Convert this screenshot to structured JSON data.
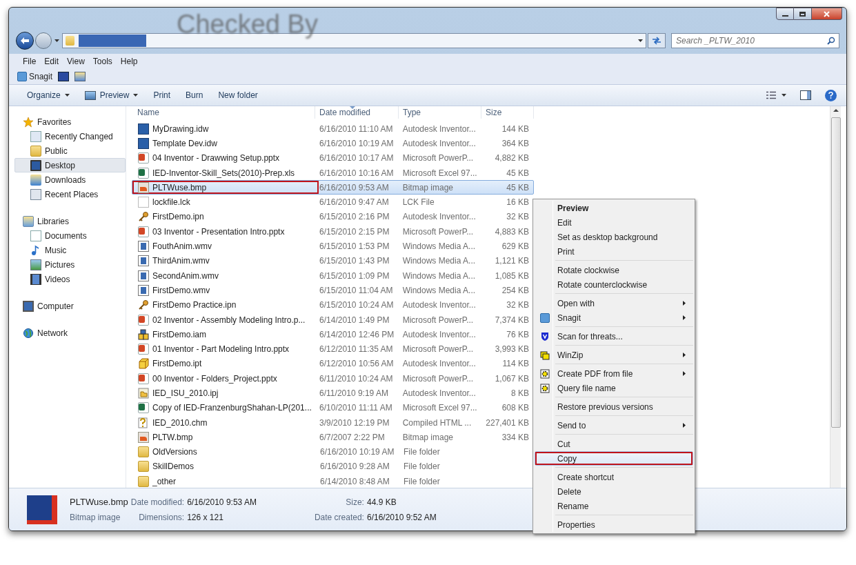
{
  "backdrop_text": "Checked By",
  "address_bar": {
    "search": {
      "placeholder": "Search _PLTW_2010"
    }
  },
  "menu_bar": [
    "File",
    "Edit",
    "View",
    "Tools",
    "Help"
  ],
  "snagit_toolbar": {
    "label": "Snagit"
  },
  "command_bar": [
    {
      "label": "Organize",
      "dropdown": true,
      "kind": "plain"
    },
    {
      "label": "Preview",
      "dropdown": true,
      "kind": "preview"
    },
    {
      "label": "Print",
      "dropdown": false,
      "kind": "plain"
    },
    {
      "label": "Burn",
      "dropdown": false,
      "kind": "plain"
    },
    {
      "label": "New folder",
      "dropdown": false,
      "kind": "plain"
    }
  ],
  "sidebar": [
    {
      "label": "Favorites",
      "kind": "star",
      "children": [
        {
          "label": "Recently Changed",
          "kind": "recent",
          "selected": false
        },
        {
          "label": "Public",
          "kind": "folder",
          "selected": false
        },
        {
          "label": "Desktop",
          "kind": "desktop",
          "selected": true
        },
        {
          "label": "Downloads",
          "kind": "downloads",
          "selected": false
        },
        {
          "label": "Recent Places",
          "kind": "places",
          "selected": false
        }
      ]
    },
    {
      "label": "Libraries",
      "kind": "libraries",
      "children": [
        {
          "label": "Documents",
          "kind": "documents",
          "selected": false
        },
        {
          "label": "Music",
          "kind": "music",
          "selected": false
        },
        {
          "label": "Pictures",
          "kind": "pictures",
          "selected": false
        },
        {
          "label": "Videos",
          "kind": "videos",
          "selected": false
        }
      ]
    },
    {
      "label": "Computer",
      "kind": "computer"
    },
    {
      "label": "Network",
      "kind": "network"
    }
  ],
  "table": {
    "columns": [
      {
        "label": "Name",
        "sorted": false
      },
      {
        "label": "Date modified",
        "sorted": true
      },
      {
        "label": "Type",
        "sorted": false
      },
      {
        "label": "Size",
        "sorted": false
      }
    ],
    "rows": [
      {
        "name": "MyDrawing.idw",
        "date": "6/16/2010 11:10 AM",
        "type": "Autodesk Inventor...",
        "size": "144 KB",
        "kind": "drawing",
        "selected": false
      },
      {
        "name": "Template Dev.idw",
        "date": "6/16/2010 10:19 AM",
        "type": "Autodesk Inventor...",
        "size": "364 KB",
        "kind": "drawing",
        "selected": false
      },
      {
        "name": "04 Inventor - Drawwing Setup.pptx",
        "date": "6/16/2010 10:17 AM",
        "type": "Microsoft PowerP...",
        "size": "4,882 KB",
        "kind": "slides",
        "selected": false
      },
      {
        "name": "IED-Inventor-Skill_Sets(2010)-Prep.xls",
        "date": "6/16/2010 10:16 AM",
        "type": "Microsoft Excel 97...",
        "size": "45 KB",
        "kind": "sheet",
        "selected": false
      },
      {
        "name": "PLTWuse.bmp",
        "date": "6/16/2010 9:53 AM",
        "type": "Bitmap image",
        "size": "45 KB",
        "kind": "image",
        "selected": true,
        "outlined": true
      },
      {
        "name": "lockfile.lck",
        "date": "6/16/2010 9:47 AM",
        "type": "LCK File",
        "size": "16 KB",
        "kind": "blank",
        "selected": false
      },
      {
        "name": "FirstDemo.ipn",
        "date": "6/15/2010 2:16 PM",
        "type": "Autodesk Inventor...",
        "size": "32 KB",
        "kind": "presentation",
        "selected": false
      },
      {
        "name": "03 Inventor - Presentation Intro.pptx",
        "date": "6/15/2010 2:15 PM",
        "type": "Microsoft PowerP...",
        "size": "4,883 KB",
        "kind": "slides",
        "selected": false
      },
      {
        "name": "FouthAnim.wmv",
        "date": "6/15/2010 1:53 PM",
        "type": "Windows Media A...",
        "size": "629 KB",
        "kind": "video",
        "selected": false
      },
      {
        "name": "ThirdAnim.wmv",
        "date": "6/15/2010 1:43 PM",
        "type": "Windows Media A...",
        "size": "1,121 KB",
        "kind": "video",
        "selected": false
      },
      {
        "name": "SecondAnim.wmv",
        "date": "6/15/2010 1:09 PM",
        "type": "Windows Media A...",
        "size": "1,085 KB",
        "kind": "video",
        "selected": false
      },
      {
        "name": "FirstDemo.wmv",
        "date": "6/15/2010 11:04 AM",
        "type": "Windows Media A...",
        "size": "254 KB",
        "kind": "video",
        "selected": false
      },
      {
        "name": "FirstDemo Practice.ipn",
        "date": "6/15/2010 10:24 AM",
        "type": "Autodesk Inventor...",
        "size": "32 KB",
        "kind": "presentation",
        "selected": false
      },
      {
        "name": "02 Inventor - Assembly Modeling Intro.p...",
        "date": "6/14/2010 1:49 PM",
        "type": "Microsoft PowerP...",
        "size": "7,374 KB",
        "kind": "slides",
        "selected": false
      },
      {
        "name": "FirstDemo.iam",
        "date": "6/14/2010 12:46 PM",
        "type": "Autodesk Inventor...",
        "size": "76 KB",
        "kind": "assembly",
        "selected": false
      },
      {
        "name": "01 Inventor - Part Modeling Intro.pptx",
        "date": "6/12/2010 11:35 AM",
        "type": "Microsoft PowerP...",
        "size": "3,993 KB",
        "kind": "slides",
        "selected": false
      },
      {
        "name": "FirstDemo.ipt",
        "date": "6/12/2010 10:56 AM",
        "type": "Autodesk Inventor...",
        "size": "114 KB",
        "kind": "part",
        "selected": false
      },
      {
        "name": "00 Inventor - Folders_Project.pptx",
        "date": "6/11/2010 10:24 AM",
        "type": "Microsoft PowerP...",
        "size": "1,067 KB",
        "kind": "slides",
        "selected": false
      },
      {
        "name": "IED_ISU_2010.ipj",
        "date": "6/11/2010 9:19 AM",
        "type": "Autodesk Inventor...",
        "size": "8 KB",
        "kind": "project",
        "selected": false
      },
      {
        "name": "Copy of IED-FranzenburgShahan-LP(201...",
        "date": "6/10/2010 11:11 AM",
        "type": "Microsoft Excel 97...",
        "size": "608 KB",
        "kind": "sheet",
        "selected": false
      },
      {
        "name": "IED_2010.chm",
        "date": "3/9/2010 12:19 PM",
        "type": "Compiled HTML ...",
        "size": "227,401 KB",
        "kind": "help",
        "selected": false
      },
      {
        "name": "PLTW.bmp",
        "date": "6/7/2007 2:22 PM",
        "type": "Bitmap image",
        "size": "334 KB",
        "kind": "image",
        "selected": false
      },
      {
        "name": "OldVersions",
        "date": "6/16/2010 10:19 AM",
        "type": "File folder",
        "kind": "folder",
        "selected": false
      },
      {
        "name": "SkillDemos",
        "date": "6/16/2010 9:28 AM",
        "type": "File folder",
        "kind": "folder",
        "selected": false
      },
      {
        "name": "_other",
        "date": "6/14/2010 8:48 AM",
        "type": "File folder",
        "kind": "folder",
        "selected": false
      }
    ]
  },
  "details_pane": {
    "name": "PLTWuse.bmp",
    "type": "Bitmap image",
    "fields": [
      {
        "label": "Date modified:",
        "value": "6/16/2010 9:53 AM"
      },
      {
        "label": "Size:",
        "value": "44.9 KB"
      },
      {
        "label": "Dimensions:",
        "value": "126 x 121"
      },
      {
        "label": "Date created:",
        "value": "6/16/2010 9:52 AM"
      }
    ]
  },
  "context_menu": [
    [
      {
        "label": "Preview",
        "default": true,
        "submenu": false,
        "selected": false
      },
      {
        "label": "Edit",
        "default": false,
        "submenu": false,
        "selected": false
      },
      {
        "label": "Set as desktop background",
        "default": false,
        "submenu": false,
        "selected": false
      },
      {
        "label": "Print",
        "default": false,
        "submenu": false,
        "selected": false
      }
    ],
    [
      {
        "label": "Rotate clockwise",
        "default": false,
        "submenu": false,
        "selected": false
      },
      {
        "label": "Rotate counterclockwise",
        "default": false,
        "submenu": false,
        "selected": false
      }
    ],
    [
      {
        "label": "Open with",
        "default": false,
        "submenu": true,
        "selected": false
      },
      {
        "label": "Snagit",
        "default": false,
        "submenu": true,
        "selected": false,
        "kind": "snagit"
      }
    ],
    [
      {
        "label": "Scan for threats...",
        "default": false,
        "submenu": false,
        "selected": false,
        "kind": "shield"
      }
    ],
    [
      {
        "label": "WinZip",
        "default": false,
        "submenu": true,
        "selected": false,
        "kind": "zip"
      }
    ],
    [
      {
        "label": "Create PDF from file",
        "default": false,
        "submenu": true,
        "selected": false,
        "kind": "gear"
      },
      {
        "label": "Query file name",
        "default": false,
        "submenu": false,
        "selected": false,
        "kind": "gear"
      }
    ],
    [
      {
        "label": "Restore previous versions",
        "default": false,
        "submenu": false,
        "selected": false
      }
    ],
    [
      {
        "label": "Send to",
        "default": false,
        "submenu": true,
        "selected": false
      }
    ],
    [
      {
        "label": "Cut",
        "default": false,
        "submenu": false,
        "selected": false
      },
      {
        "label": "Copy",
        "default": false,
        "submenu": false,
        "selected": true,
        "outlined": true
      }
    ],
    [
      {
        "label": "Create shortcut",
        "default": false,
        "submenu": false,
        "selected": false
      },
      {
        "label": "Delete",
        "default": false,
        "submenu": false,
        "selected": false
      },
      {
        "label": "Rename",
        "default": false,
        "submenu": false,
        "selected": false
      }
    ],
    [
      {
        "label": "Properties",
        "default": false,
        "submenu": false,
        "selected": false
      }
    ]
  ]
}
